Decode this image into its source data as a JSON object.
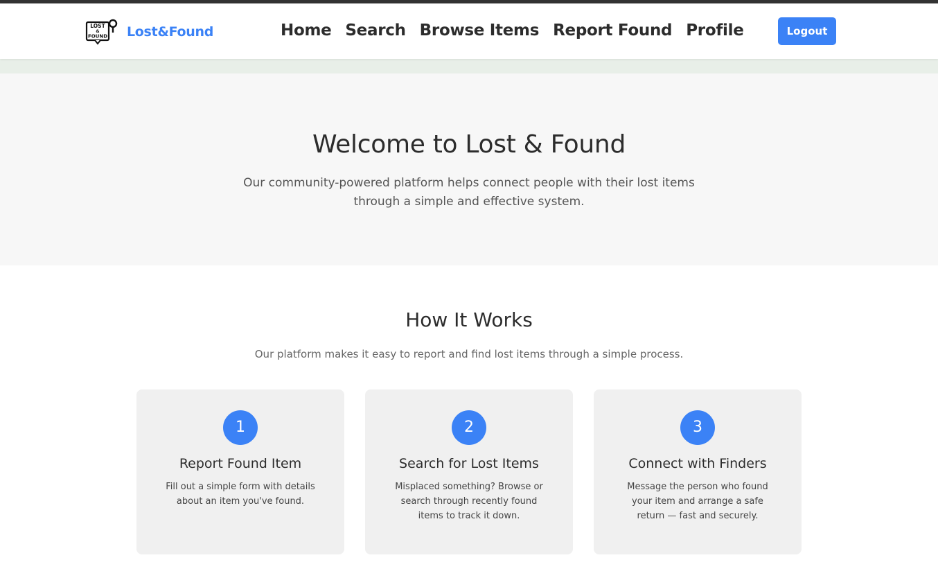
{
  "brand": {
    "name": "Lost&Found",
    "logo_text": [
      "LOST",
      "&",
      "FOUND"
    ],
    "logo_icon": "magnifier-tag-icon"
  },
  "nav": {
    "items": [
      {
        "label": "Home"
      },
      {
        "label": "Search"
      },
      {
        "label": "Browse Items"
      },
      {
        "label": "Report Found"
      },
      {
        "label": "Profile"
      }
    ],
    "logout_label": "Logout"
  },
  "hero": {
    "title": "Welcome to Lost & Found",
    "subtitle": "Our community-powered platform helps connect people with their lost items through a simple and effective system."
  },
  "how_it_works": {
    "title": "How It Works",
    "subtitle": "Our platform makes it easy to report and find lost items through a simple process.",
    "steps": [
      {
        "number": "1",
        "title": "Report Found Item",
        "text": "Fill out a simple form with details about an item you've found."
      },
      {
        "number": "2",
        "title": "Search for Lost Items",
        "text": "Misplaced something? Browse or search through recently found items to track it down."
      },
      {
        "number": "3",
        "title": "Connect with Finders",
        "text": "Message the person who found your item and arrange a safe return — fast and securely."
      }
    ]
  },
  "colors": {
    "accent": "#3b82f6",
    "text": "#2c2c2c",
    "hero_bg": "#f7f7f7",
    "card_bg": "#f0f0f0"
  }
}
